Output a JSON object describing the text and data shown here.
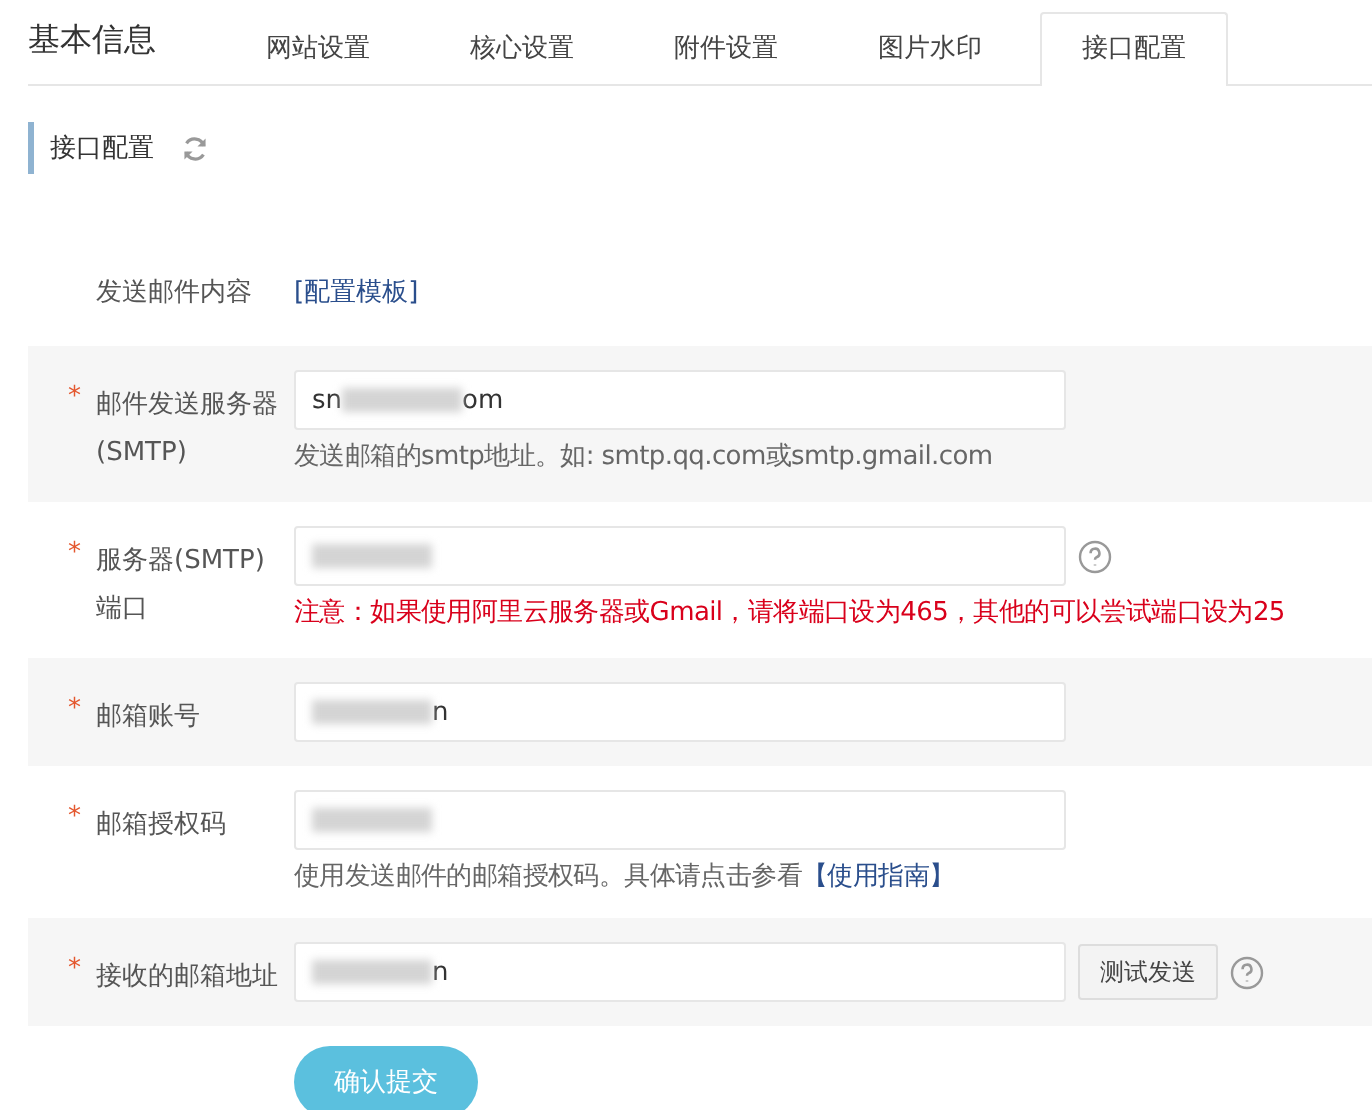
{
  "page_title": "基本信息",
  "tabs": [
    {
      "label": "网站设置",
      "selected": false
    },
    {
      "label": "核心设置",
      "selected": false
    },
    {
      "label": "附件设置",
      "selected": false
    },
    {
      "label": "图片水印",
      "selected": false
    },
    {
      "label": "接口配置",
      "selected": true
    }
  ],
  "section": {
    "title": "接口配置"
  },
  "template_row": {
    "label": "发送邮件内容",
    "link": "[配置模板]"
  },
  "fields": [
    {
      "label": "邮件发送服务器",
      "label_line2": "(SMTP)",
      "required_mark": "*",
      "value_parts": [
        {
          "kind": "text",
          "text": "sn"
        },
        {
          "kind": "redacted"
        },
        {
          "kind": "text",
          "text": "om"
        }
      ],
      "hint": {
        "kind": "plain",
        "text": "发送邮箱的smtp地址。如: smtp.qq.com或smtp.gmail.com"
      }
    },
    {
      "label": "服务器(SMTP)",
      "label_line2": "端口",
      "required_mark": "*",
      "value_parts": [
        {
          "kind": "redacted"
        }
      ],
      "help": true,
      "hint": {
        "kind": "warning",
        "text": "注意：如果使用阿里云服务器或Gmail，请将端口设为465，其他的可以尝试端口设为25"
      }
    },
    {
      "label": "邮箱账号",
      "required_mark": "*",
      "value_parts": [
        {
          "kind": "redacted"
        },
        {
          "kind": "text",
          "text": "n"
        }
      ]
    },
    {
      "label": "邮箱授权码",
      "required_mark": "*",
      "value_parts": [
        {
          "kind": "redacted"
        }
      ],
      "hint": {
        "kind": "plain",
        "text": "使用发送邮件的邮箱授权码。具体请点击参看",
        "link": "【使用指南】"
      }
    },
    {
      "label": "接收的邮箱地址",
      "required_mark": "*",
      "value_parts": [
        {
          "kind": "redacted"
        },
        {
          "kind": "text",
          "text": "n"
        }
      ],
      "button": "测试发送",
      "help": true
    }
  ],
  "submit": "确认提交"
}
